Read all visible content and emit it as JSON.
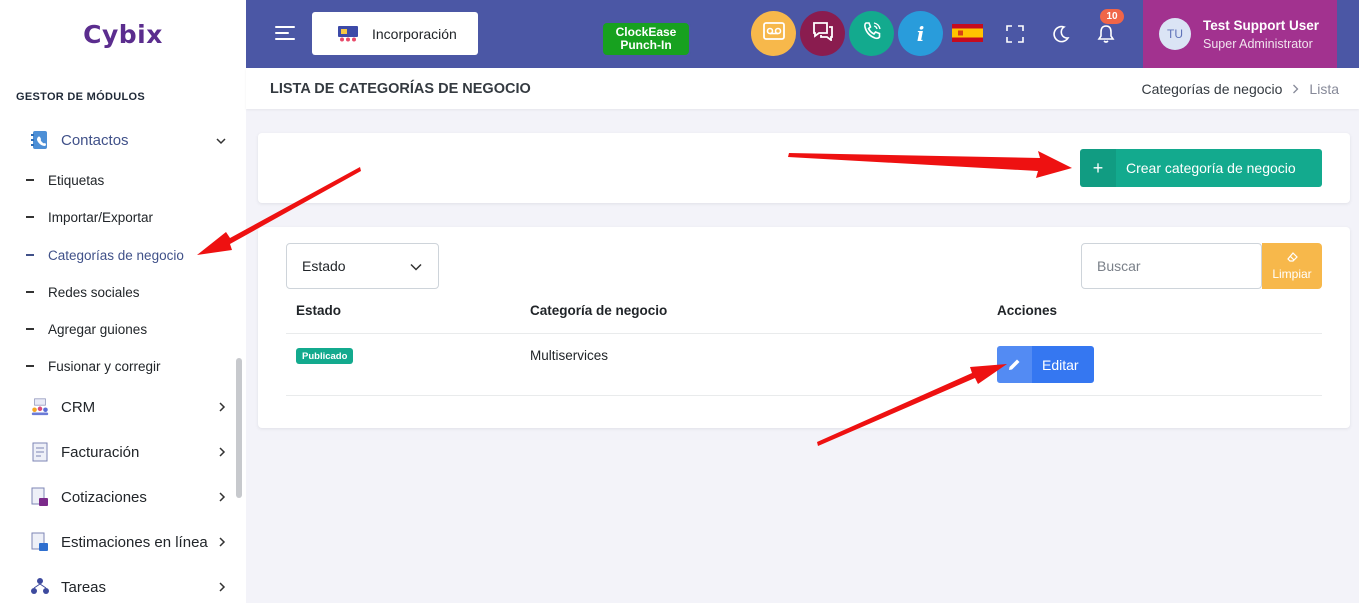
{
  "app": {
    "logo": "Cybix"
  },
  "sidebar": {
    "section_title": "GESTOR DE MÓDULOS",
    "contacts_label": "Contactos",
    "sub_items": [
      "Etiquetas",
      "Importar/Exportar",
      "Categorías de negocio",
      "Redes sociales",
      "Agregar guiones",
      "Fusionar y corregir"
    ],
    "items": [
      "CRM",
      "Facturación",
      "Cotizaciones",
      "Estimaciones en línea",
      "Tareas"
    ]
  },
  "topbar": {
    "onboarding_label": "Incorporación",
    "clock_line1": "ClockEase",
    "clock_line2": "Punch-In",
    "notifications_count": "10",
    "user_initials": "TU",
    "user_name": "Test Support User",
    "user_role": "Super Administrator",
    "colors": {
      "bar": "#4b57a5",
      "user_bg": "#a2328f"
    }
  },
  "page": {
    "title": "LISTA DE CATEGORÍAS DE NEGOCIO",
    "breadcrumb": [
      "Categorías de negocio",
      "Lista"
    ],
    "create_button": "Crear categoría de negocio"
  },
  "filters": {
    "status_select": "Estado",
    "search_placeholder": "Buscar",
    "clear_label": "Limpiar"
  },
  "table": {
    "headers": [
      "Estado",
      "Categoría de negocio",
      "Acciones"
    ],
    "rows": [
      {
        "status": "Publicado",
        "category": "Multiservices",
        "action": "Editar"
      }
    ]
  }
}
